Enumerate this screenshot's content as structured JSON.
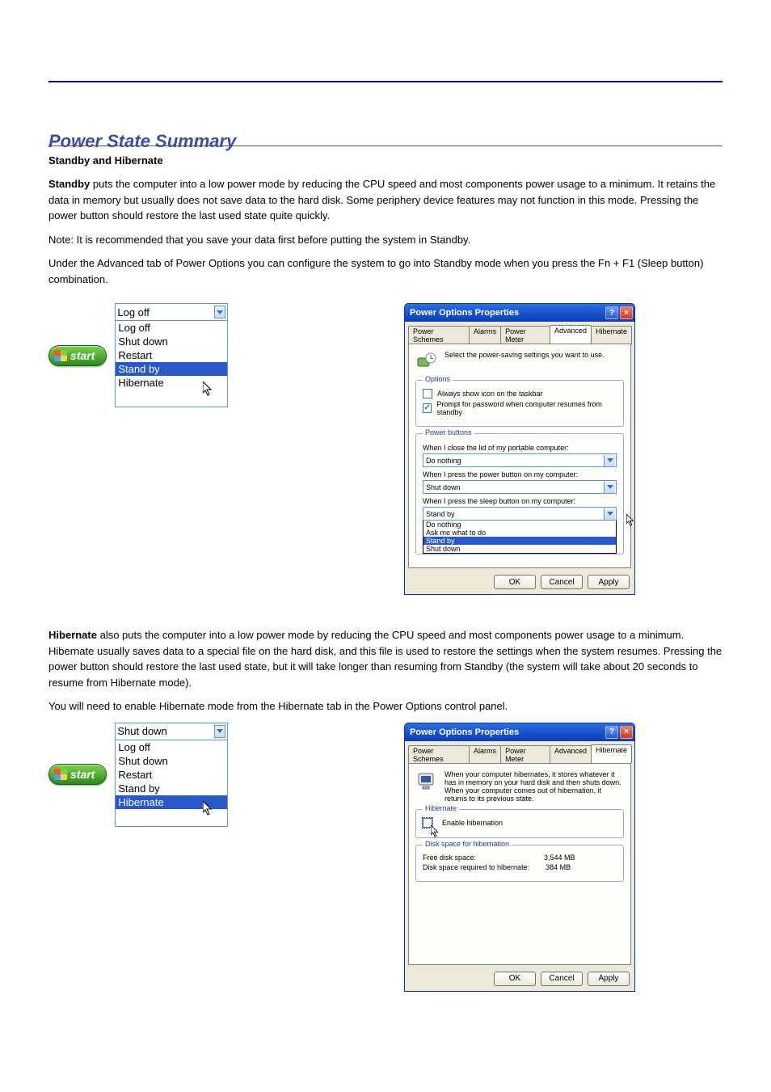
{
  "text": {
    "section_title": "Power State Summary",
    "standby_heading": "Standby and Hibernate",
    "standby_label": "Standby",
    "standby_body": "puts the computer into a low power mode by reducing the CPU speed and most components power usage to a minimum. It retains the data in memory but usually does not save data to the hard disk. Some periphery device features may not function in this mode. Pressing the power button should restore the last used state quite quickly.",
    "standby_note": "Note: It is recommended that you save your data first before putting the system in Standby.",
    "standby_adv_intro": "Under the Advanced tab of Power Options you can configure the system to go into Standby mode when you press the Fn + F1 (Sleep button) combination.",
    "hibernate_label": "Hibernate",
    "hibernate_body": "also puts the computer into a low power mode by reducing the CPU speed and most components power usage to a minimum. Hibernate usually saves data to a special file on the hard disk, and this file is used to restore the settings when the system resumes. Pressing the power button should restore the last used state, but it will take longer than resuming from Standby (the system will take about 20 seconds to resume from Hibernate mode).",
    "hibernate_enable_intro": "You will need to enable Hibernate mode from the Hibernate tab in the Power Options control panel."
  },
  "startMenu": {
    "label": "start",
    "combo1": {
      "selected": "Log off",
      "items": [
        "Log off",
        "Shut down",
        "Restart",
        "Stand by",
        "Hibernate"
      ],
      "highlight": "Stand by"
    },
    "combo2": {
      "selected": "Shut down",
      "items": [
        "Log off",
        "Shut down",
        "Restart",
        "Stand by",
        "Hibernate"
      ],
      "highlight": "Hibernate"
    }
  },
  "dialog": {
    "title": "Power Options Properties",
    "tabs": [
      "Power Schemes",
      "Alarms",
      "Power Meter",
      "Advanced",
      "Hibernate"
    ],
    "buttons": {
      "ok": "OK",
      "cancel": "Cancel",
      "apply": "Apply"
    },
    "advanced": {
      "intro": "Select the power-saving settings you want to use.",
      "group_options": "Options",
      "chk_show_icon": "Always show icon on the taskbar",
      "chk_prompt_pw": "Prompt for password when computer resumes from standby",
      "group_power_buttons": "Power buttons",
      "lbl_lid": "When I close the lid of my portable computer:",
      "sel_lid": "Do nothing",
      "lbl_power": "When I press the power button on my computer:",
      "sel_power": "Shut down",
      "lbl_sleep": "When I press the sleep button on my computer:",
      "sel_sleep": "Stand by",
      "sleep_list": [
        "Do nothing",
        "Ask me what to do",
        "Stand by",
        "Shut down"
      ]
    },
    "hibernate": {
      "desc": "When your computer hibernates, it stores whatever it has in memory on your hard disk and then shuts down. When your computer comes out of hibernation, it returns to its previous state.",
      "group_hibernate": "Hibernate",
      "chk_enable": "Enable hibernation",
      "group_disk": "Disk space for hibernation",
      "free_label": "Free disk space:",
      "free_value": "3,544 MB",
      "req_label": "Disk space required to hibernate:",
      "req_value": "384 MB"
    }
  }
}
